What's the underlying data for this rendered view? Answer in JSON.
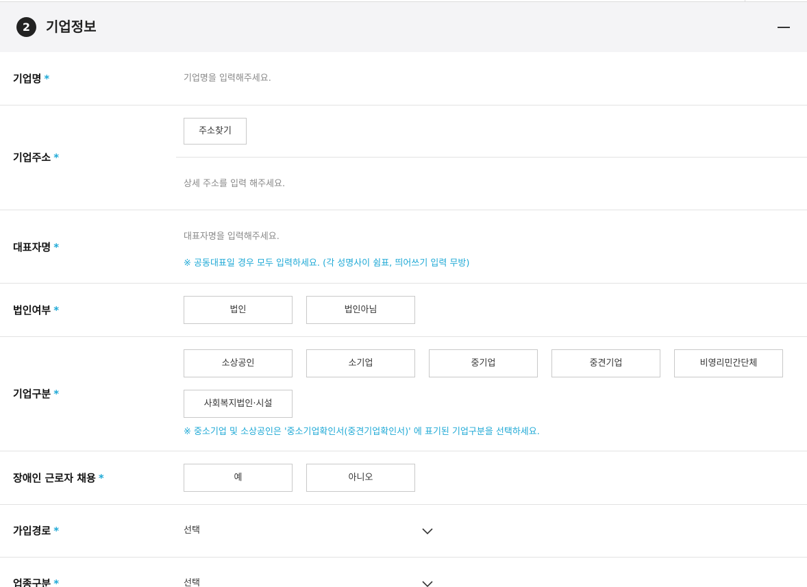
{
  "section": {
    "step": "2",
    "title": "기업정보"
  },
  "required_mark": "*",
  "fields": {
    "company_name": {
      "label": "기업명",
      "placeholder": "기업명을 입력해주세요."
    },
    "company_address": {
      "label": "기업주소",
      "search_button": "주소찾기",
      "detail_placeholder": "상세 주소를 입력 해주세요."
    },
    "representative": {
      "label": "대표자명",
      "placeholder": "대표자명을 입력해주세요.",
      "hint": "※ 공동대표일 경우 모두 입력하세요. (각 성명사이 쉼표, 띄어쓰기 입력 무방)"
    },
    "corporation": {
      "label": "법인여부",
      "options": [
        "법인",
        "법인아님"
      ]
    },
    "company_type": {
      "label": "기업구분",
      "options": [
        "소상공인",
        "소기업",
        "중기업",
        "중견기업",
        "비영리민간단체",
        "사회복지법인·시설"
      ],
      "hint": "※ 중소기업 및 소상공인은 '중소기업확인서(중견기업확인서)' 에 표기된 기업구분을 선택하세요."
    },
    "disabled_hiring": {
      "label": "장애인 근로자 채용",
      "options": [
        "예",
        "아니오"
      ]
    },
    "join_path": {
      "label": "가입경로",
      "selected": "선택"
    },
    "industry": {
      "label": "업종구분",
      "selected": "선택"
    }
  },
  "colors": {
    "accent": "#1fa9d6",
    "header_bg": "#f4f4f6"
  }
}
